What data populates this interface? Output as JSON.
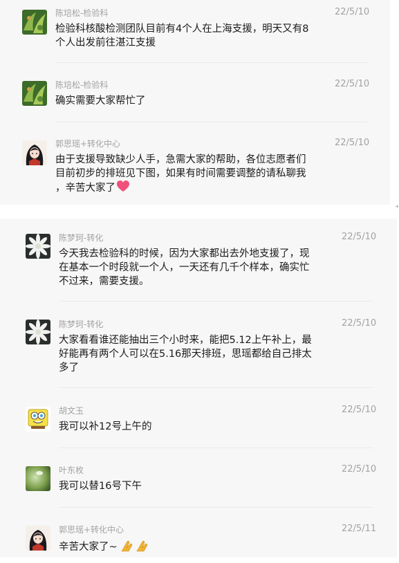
{
  "messages": [
    {
      "name": "陈培松-检验科",
      "date": "22/5/10",
      "text": "检验科核酸检测团队目前有4个人在上海支援，明天又有8\n个人出发前往湛江支援",
      "avatar": "green-plant-avatar"
    },
    {
      "name": "陈培松-检验科",
      "date": "22/5/10",
      "text": "确实需要大家帮忙了",
      "avatar": "green-plant-avatar"
    },
    {
      "name": "郭思瑶+转化中心",
      "date": "22/5/10",
      "text": "由于支援导致缺少人手，急需大家的帮助，各位志愿者们\n目前初步的排班见下图，如果有时间需要调整的请私聊我\n，辛苦大家了",
      "avatar": "anime-girl-avatar",
      "emoji": "heart-icon"
    },
    {
      "name": "陈梦珂-转化",
      "date": "22/5/10",
      "text": "今天我去检验科的时候，因为大家都出去外地支援了，现\n在基本一个时段就一个人，一天还有几千个样本，确实忙\n不过来，需要支援。",
      "avatar": "white-flower-avatar"
    },
    {
      "name": "陈梦珂-转化",
      "date": "22/5/10",
      "text": "大家看看谁还能抽出三个小时来，能把5.12上午补上，最\n好能再有两个人可以在5.16那天排班，思瑶都给自己排太\n多了",
      "avatar": "white-flower-avatar"
    },
    {
      "name": "胡文玉",
      "date": "22/5/10",
      "text": "我可以补12号上午的",
      "avatar": "cartoon-sponge-avatar"
    },
    {
      "name": "叶东枚",
      "date": "22/5/10",
      "text": "我可以替16号下午",
      "avatar": "green-blur-avatar"
    },
    {
      "name": "郭思瑶+转化中心",
      "date": "22/5/11",
      "text": "辛苦大家了~",
      "avatar": "anime-girl-avatar",
      "emoji": "praying-hands-icon"
    }
  ],
  "colors": {
    "panel_bg": "#f7f7f7",
    "name": "#a2a2a2",
    "text": "#1b1b1b",
    "heart": "#f0507a"
  }
}
